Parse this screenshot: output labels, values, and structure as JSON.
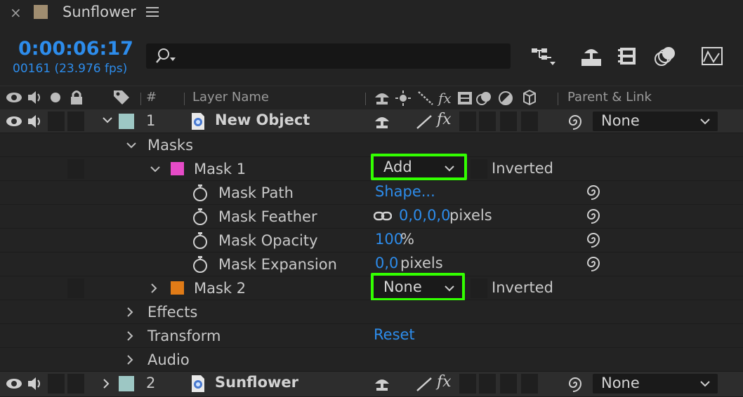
{
  "window": {
    "title": "Sunflower"
  },
  "timecode": {
    "value": "0:00:06:17",
    "frames": "00161 (23.976 fps)"
  },
  "search": {
    "placeholder": ""
  },
  "columns": {
    "index": "#",
    "layer_name": "Layer Name",
    "parent_link": "Parent & Link"
  },
  "layers": [
    {
      "index": "1",
      "name": "New Object",
      "label_color": "#9dc7c4",
      "parent": "None",
      "children": {
        "masks": "Masks",
        "mask1": {
          "name": "Mask 1",
          "color": "#e64bc7",
          "mode": "Add",
          "inverted": "Inverted",
          "properties": [
            {
              "name": "Mask Path",
              "value": "Shape...",
              "unit": ""
            },
            {
              "name": "Mask Feather",
              "value": "0,0,0,0",
              "unit": "pixels"
            },
            {
              "name": "Mask Opacity",
              "value": "100",
              "unit": "%"
            },
            {
              "name": "Mask Expansion",
              "value": "0,0",
              "unit": "pixels"
            }
          ]
        },
        "mask2": {
          "name": "Mask 2",
          "color": "#e07b17",
          "mode": "None",
          "inverted": "Inverted"
        },
        "effects": "Effects",
        "transform": "Transform",
        "transform_reset": "Reset",
        "audio": "Audio"
      }
    },
    {
      "index": "2",
      "name": "Sunflower",
      "label_color": "#9dc7c4",
      "parent": "None"
    }
  ],
  "colors": {
    "accent": "#2d8ceb",
    "highlight": "#33ff00"
  }
}
